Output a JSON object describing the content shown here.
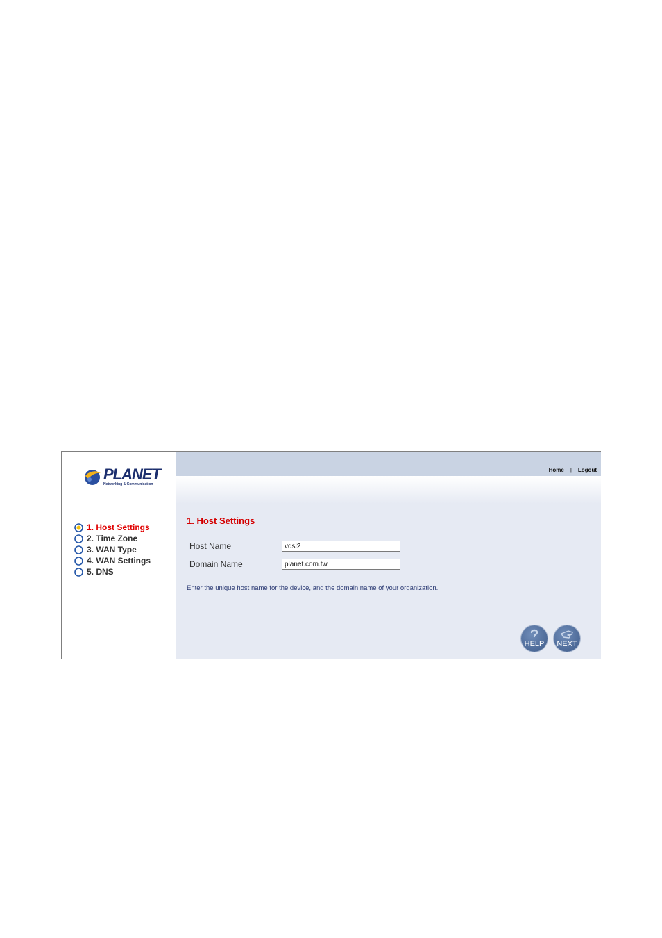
{
  "brand": {
    "name": "PLANET",
    "tagline": "Networking & Communication"
  },
  "header": {
    "links": [
      "Home",
      "Logout"
    ],
    "separator": "|"
  },
  "steps": [
    {
      "label": "1. Host Settings",
      "active": true
    },
    {
      "label": "2. Time Zone",
      "active": false
    },
    {
      "label": "3. WAN Type",
      "active": false
    },
    {
      "label": "4. WAN Settings",
      "active": false
    },
    {
      "label": "5. DNS",
      "active": false
    }
  ],
  "section": {
    "title": "1. Host Settings"
  },
  "form": {
    "host_name_label": "Host Name",
    "host_name_value": "vdsl2",
    "domain_name_label": "Domain Name",
    "domain_name_value": "planet.com.tw"
  },
  "hint": "Enter the unique host name for the device, and the domain name of your organization.",
  "buttons": {
    "help": "HELP",
    "next": "NEXT"
  },
  "colors": {
    "active_step": "#e00000",
    "title": "#d40000",
    "header_bar": "#c9d3e3",
    "panel": "#e6eaf3",
    "button": "#4a6796"
  }
}
